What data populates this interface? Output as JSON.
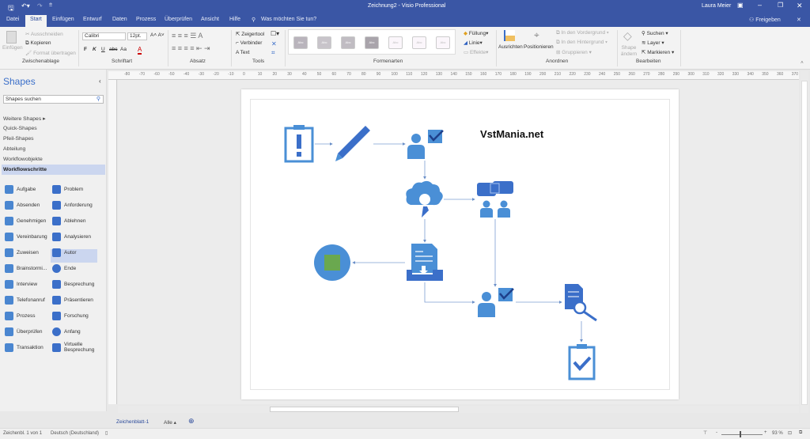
{
  "titlebar": {
    "title": "Zeichnung2 - Visio Professional",
    "user": "Laura Meier",
    "share": "Freigeben"
  },
  "tabs": [
    "Datei",
    "Start",
    "Einfügen",
    "Entwurf",
    "Daten",
    "Prozess",
    "Überprüfen",
    "Ansicht",
    "Hilfe"
  ],
  "tell_me": "Was möchten Sie tun?",
  "ribbon": {
    "clipboard": {
      "paste": "Einfügen",
      "cut": "Ausschneiden",
      "copy": "Kopieren",
      "format": "Format übertragen",
      "label": "Zwischenablage"
    },
    "font": {
      "name": "Calibri",
      "size": "12pt.",
      "bold": "F",
      "italic": "K",
      "underline": "U",
      "strike": "abc",
      "case": "Aa",
      "label": "Schriftart"
    },
    "paragraph": {
      "label": "Absatz"
    },
    "tools": {
      "pointer": "Zeigertool",
      "connector": "Verbinder",
      "text": "Text",
      "label": "Tools"
    },
    "styles": {
      "label": "Formenarten",
      "swatch": "Abc",
      "fill": "Füllung",
      "line": "Linie",
      "effects": "Effekte"
    },
    "arrange": {
      "align": "Ausrichten",
      "position": "Positionieren",
      "front": "In den Vordergrund",
      "back": "In den Hintergrund",
      "group": "Gruppieren",
      "label": "Anordnen"
    },
    "edit": {
      "change_shape": "Shape ändern",
      "find": "Suchen",
      "layer": "Layer",
      "select": "Markieren",
      "label": "Bearbeiten"
    }
  },
  "shapes_panel": {
    "title": "Shapes",
    "search_placeholder": "Shapes suchen",
    "stencils": [
      "Weitere Shapes",
      "Quick-Shapes",
      "Pfeil-Shapes",
      "Abteilung",
      "Workflowobjekte",
      "Workflowschritte"
    ],
    "items": [
      "Aufgabe",
      "Problem",
      "Absenden",
      "Anforderung",
      "Genehmigen",
      "Ablehnen",
      "Vereinbarung",
      "Analysieren",
      "Zuweisen",
      "Autor",
      "Brainstormi...",
      "Ende",
      "Interview",
      "Besprechung",
      "Telefonanruf",
      "Präsentieren",
      "Prozess",
      "Forschung",
      "Überprüfen",
      "Anfang",
      "Transaktion",
      "Virtuelle Besprechung"
    ]
  },
  "ruler": [
    "-80",
    "-70",
    "-60",
    "-50",
    "-40",
    "-30",
    "-20",
    "-10",
    "0",
    "10",
    "20",
    "30",
    "40",
    "50",
    "60",
    "70",
    "80",
    "90",
    "100",
    "110",
    "120",
    "130",
    "140",
    "150",
    "160",
    "170",
    "180",
    "190",
    "200",
    "210",
    "220",
    "230",
    "240",
    "250",
    "260",
    "270",
    "280",
    "290",
    "300",
    "310",
    "320",
    "330",
    "340",
    "350",
    "360",
    "370"
  ],
  "diagram": {
    "watermark": "VstMania.net",
    "accent": "#4a8fd6",
    "dark": "#3b6fc9",
    "green": "#6aa84f"
  },
  "sheets": {
    "active": "Zeichenblatt-1",
    "all": "Alle"
  },
  "status": {
    "page": "Zeichenbl. 1 von 1",
    "language": "Deutsch (Deutschland)",
    "zoom": "93 %"
  }
}
